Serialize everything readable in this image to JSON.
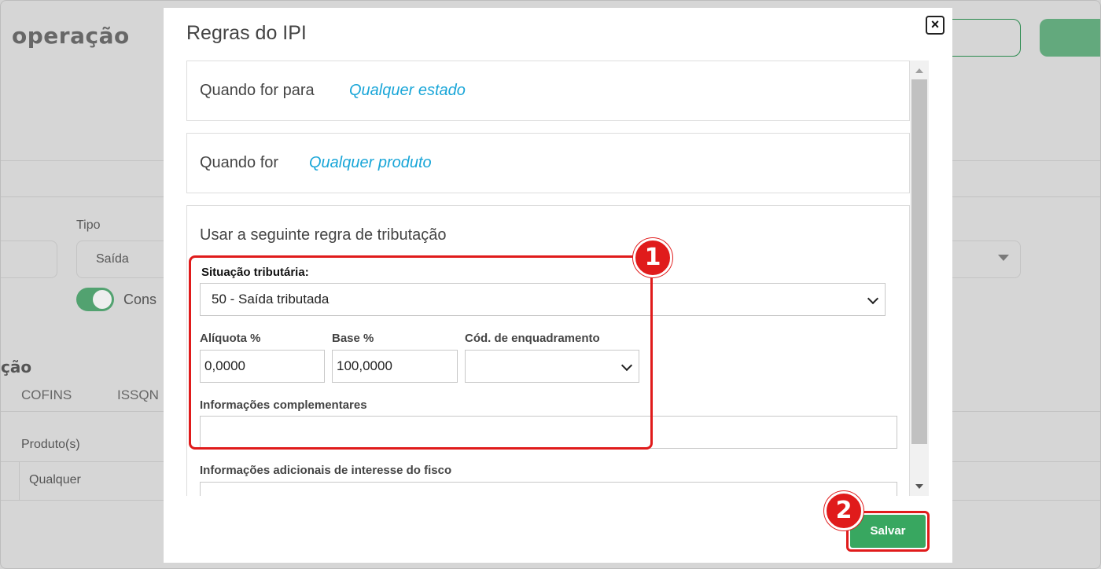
{
  "background": {
    "page_title": "operação",
    "tipo_label": "Tipo",
    "tipo_value": "Saída",
    "toggle_label": "Cons",
    "section_title": "ção",
    "tabs": [
      "COFINS",
      "ISSQN"
    ],
    "table_header": "Produto(s)",
    "table_cell": "Qualquer"
  },
  "modal": {
    "title": "Regras do IPI",
    "close_icon": "close-icon",
    "estado": {
      "label": "Quando for para",
      "value": "Qualquer estado"
    },
    "produto": {
      "label": "Quando for",
      "value": "Qualquer produto"
    },
    "regra": {
      "heading": "Usar a seguinte regra de tributação",
      "situacao_label": "Situação tributária:",
      "situacao_value": "50 - Saída tributada",
      "aliquota_label": "Alíquota %",
      "aliquota_value": "0,0000",
      "base_label": "Base %",
      "base_value": "100,0000",
      "enquadramento_label": "Cód. de enquadramento",
      "enquadramento_value": "",
      "info_comp_label": "Informações complementares",
      "info_comp_value": "",
      "info_fisco_label": "Informações adicionais de interesse do fisco"
    },
    "save_label": "Salvar"
  },
  "annotations": {
    "badge1": "1",
    "badge2": "2",
    "color": "#e01b1b"
  }
}
